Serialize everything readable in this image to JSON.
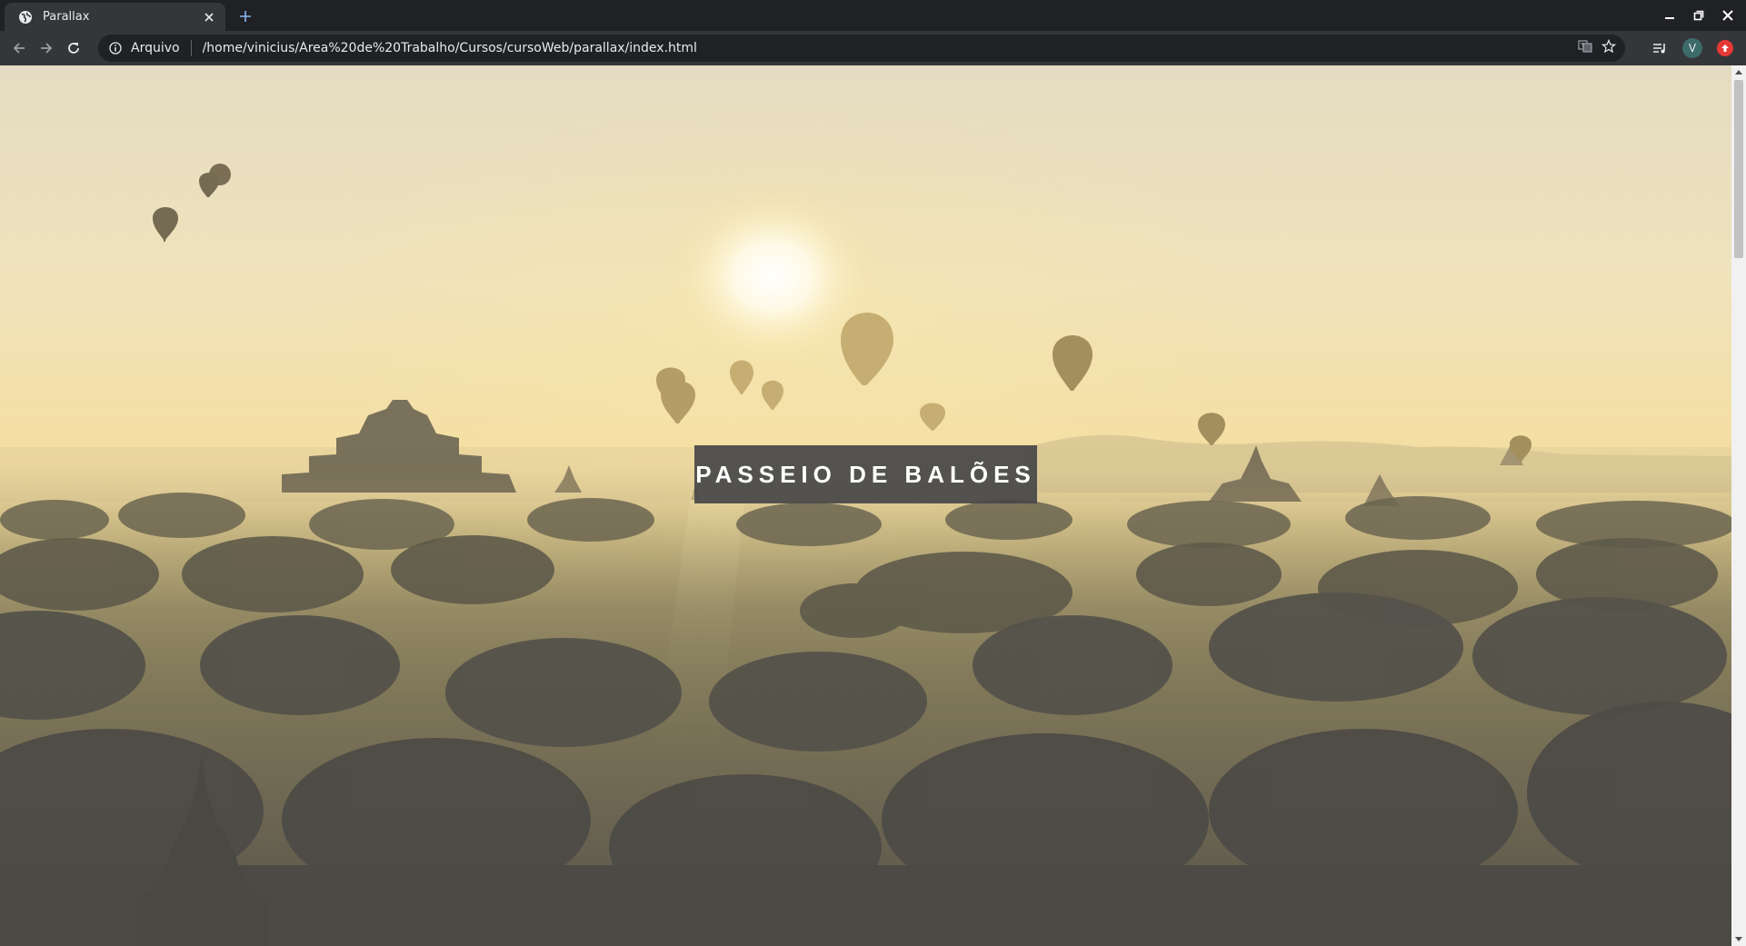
{
  "browser": {
    "tab": {
      "title": "Parallax",
      "favicon_icon": "globe-icon",
      "close_icon": "close-icon"
    },
    "new_tab_icon": "plus-icon",
    "window_controls": [
      "minimize-icon",
      "restore-icon",
      "close-icon"
    ],
    "toolbar": {
      "back_icon": "arrow-left-icon",
      "forward_icon": "arrow-right-icon",
      "reload_icon": "reload-icon",
      "info_icon": "info-icon",
      "scheme_chip": "Arquivo",
      "url": "/home/vinicius/Área%20de%20Trabalho/Cursos/cursoWeb/parallax/index.html",
      "translate_icon": "translate-icon",
      "bookmark_icon": "star-icon",
      "media_icon": "playlist-icon",
      "profile_initial": "V",
      "extension_icon": "extension-red-icon"
    }
  },
  "page": {
    "hero": {
      "title": "PASSEIO DE BALÕES",
      "background": "hot-air-balloons-sunrise-image"
    }
  },
  "colors": {
    "tabstrip_bg": "#202124",
    "toolbar_bg": "#35363a",
    "omnibox_bg": "#202124",
    "title_box_bg": "#464648",
    "title_text": "#ffffff"
  }
}
